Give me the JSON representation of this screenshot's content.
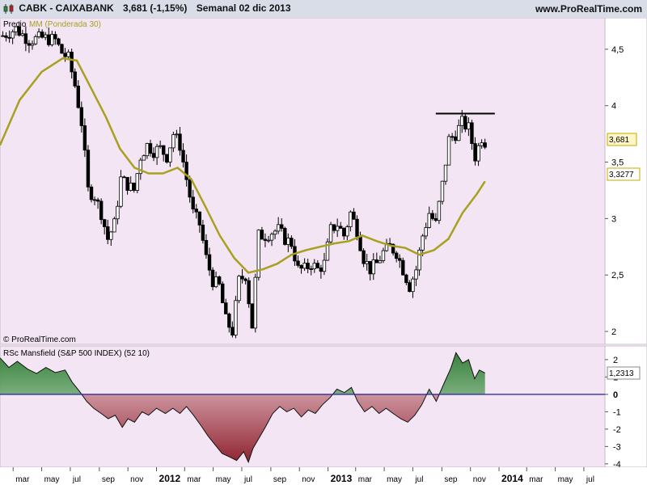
{
  "header": {
    "symbol": "CABK - CAIXABANK",
    "quote": "3,681 (-1,15%)",
    "period": "Semanal  02 dic 2013",
    "site": "www.ProRealTime.com"
  },
  "price_panel": {
    "label_precio": "Precio",
    "label_mm": "MM (Ponderada 30)",
    "copyright": "© ProRealTime.com",
    "last_price_badge": "3,681",
    "ma_badge": "3,3277"
  },
  "rsc_panel": {
    "label": "RSc Mansfield (S&P 500 INDEX) (52 10)",
    "last_badge": "1,2313"
  },
  "colors": {
    "bg_panel": "#f3e5f3",
    "ma_line": "#a8a020",
    "pos_fill": "#2e8b3a",
    "neg_fill": "#8b1a28",
    "zero_line": "#2020a0",
    "last_badge_border": "#c8a800"
  },
  "chart_data": [
    {
      "type": "candlestick",
      "title": "CABK - CAIXABANK",
      "series": [
        {
          "name": "Precio"
        },
        {
          "name": "MM (Ponderada 30)"
        }
      ],
      "yticks": [
        "4,5",
        "4",
        "3,5",
        "3",
        "2,5",
        "2"
      ],
      "ylim": [
        1.9,
        4.75
      ],
      "x_ticks": [
        "mar",
        "may",
        "jul",
        "sep",
        "nov",
        "2012",
        "mar",
        "may",
        "jul",
        "sep",
        "nov",
        "2013",
        "mar",
        "may",
        "jul",
        "sep",
        "nov",
        "2014",
        "mar",
        "may",
        "jul"
      ],
      "x_range": [
        "2011-02-01",
        "2014-08-15"
      ],
      "resistance_level": 3.93,
      "resistance_from": "2013-08-19",
      "resistance_to": "2013-12-23",
      "close_points": [
        [
          "2011-02-07",
          4.62
        ],
        [
          "2011-03-07",
          4.68
        ],
        [
          "2011-04-04",
          4.58
        ],
        [
          "2011-05-02",
          4.6
        ],
        [
          "2011-05-30",
          4.58
        ],
        [
          "2011-06-13",
          4.47
        ],
        [
          "2011-06-27",
          4.42
        ],
        [
          "2011-07-11",
          4.18
        ],
        [
          "2011-07-25",
          3.85
        ],
        [
          "2011-08-08",
          3.25
        ],
        [
          "2011-08-22",
          3.2
        ],
        [
          "2011-09-05",
          3.05
        ],
        [
          "2011-09-19",
          2.82
        ],
        [
          "2011-10-03",
          2.95
        ],
        [
          "2011-10-17",
          3.35
        ],
        [
          "2011-10-31",
          3.3
        ],
        [
          "2011-11-14",
          3.25
        ],
        [
          "2011-11-28",
          3.55
        ],
        [
          "2011-12-12",
          3.65
        ],
        [
          "2011-12-26",
          3.6
        ],
        [
          "2012-01-09",
          3.62
        ],
        [
          "2012-01-23",
          3.55
        ],
        [
          "2012-02-06",
          3.75
        ],
        [
          "2012-02-20",
          3.65
        ],
        [
          "2012-03-05",
          3.35
        ],
        [
          "2012-03-19",
          3.05
        ],
        [
          "2012-04-02",
          2.95
        ],
        [
          "2012-04-16",
          2.65
        ],
        [
          "2012-04-30",
          2.45
        ],
        [
          "2012-05-14",
          2.4
        ],
        [
          "2012-05-28",
          2.1
        ],
        [
          "2012-06-11",
          2.0
        ],
        [
          "2012-06-25",
          2.45
        ],
        [
          "2012-07-09",
          2.5
        ],
        [
          "2012-07-23",
          2.05
        ],
        [
          "2012-08-06",
          2.85
        ],
        [
          "2012-08-20",
          2.85
        ],
        [
          "2012-09-03",
          2.88
        ],
        [
          "2012-09-17",
          2.9
        ],
        [
          "2012-10-01",
          2.82
        ],
        [
          "2012-10-15",
          2.78
        ],
        [
          "2012-10-29",
          2.55
        ],
        [
          "2012-11-12",
          2.55
        ],
        [
          "2012-11-26",
          2.6
        ],
        [
          "2012-12-10",
          2.55
        ],
        [
          "2012-12-24",
          2.6
        ],
        [
          "2013-01-07",
          2.9
        ],
        [
          "2013-01-21",
          2.95
        ],
        [
          "2013-02-04",
          2.85
        ],
        [
          "2013-02-18",
          3.05
        ],
        [
          "2013-03-04",
          2.9
        ],
        [
          "2013-03-18",
          2.65
        ],
        [
          "2013-04-01",
          2.55
        ],
        [
          "2013-04-15",
          2.6
        ],
        [
          "2013-04-29",
          2.7
        ],
        [
          "2013-05-13",
          2.75
        ],
        [
          "2013-05-27",
          2.7
        ],
        [
          "2013-06-10",
          2.55
        ],
        [
          "2013-06-24",
          2.4
        ],
        [
          "2013-07-08",
          2.55
        ],
        [
          "2013-07-22",
          2.85
        ],
        [
          "2013-08-05",
          3.05
        ],
        [
          "2013-08-19",
          2.95
        ],
        [
          "2013-09-02",
          3.3
        ],
        [
          "2013-09-16",
          3.7
        ],
        [
          "2013-09-30",
          3.75
        ],
        [
          "2013-10-14",
          3.85
        ],
        [
          "2013-10-28",
          3.8
        ],
        [
          "2013-11-11",
          3.55
        ],
        [
          "2013-11-25",
          3.72
        ],
        [
          "2013-12-02",
          3.681
        ]
      ],
      "ma_points": [
        [
          "2011-02-01",
          3.65
        ],
        [
          "2011-03-15",
          4.05
        ],
        [
          "2011-05-01",
          4.3
        ],
        [
          "2011-06-15",
          4.42
        ],
        [
          "2011-07-15",
          4.4
        ],
        [
          "2011-08-15",
          4.15
        ],
        [
          "2011-09-15",
          3.9
        ],
        [
          "2011-10-15",
          3.62
        ],
        [
          "2011-11-15",
          3.45
        ],
        [
          "2011-12-15",
          3.4
        ],
        [
          "2012-01-15",
          3.4
        ],
        [
          "2012-02-15",
          3.45
        ],
        [
          "2012-03-15",
          3.35
        ],
        [
          "2012-04-15",
          3.1
        ],
        [
          "2012-05-15",
          2.85
        ],
        [
          "2012-06-15",
          2.65
        ],
        [
          "2012-07-15",
          2.52
        ],
        [
          "2012-08-15",
          2.55
        ],
        [
          "2012-09-15",
          2.6
        ],
        [
          "2012-10-15",
          2.68
        ],
        [
          "2012-11-15",
          2.72
        ],
        [
          "2012-12-15",
          2.75
        ],
        [
          "2013-01-15",
          2.78
        ],
        [
          "2013-02-15",
          2.8
        ],
        [
          "2013-03-15",
          2.85
        ],
        [
          "2013-04-15",
          2.8
        ],
        [
          "2013-05-15",
          2.76
        ],
        [
          "2013-06-15",
          2.74
        ],
        [
          "2013-07-15",
          2.68
        ],
        [
          "2013-08-15",
          2.72
        ],
        [
          "2013-09-15",
          2.82
        ],
        [
          "2013-10-15",
          3.05
        ],
        [
          "2013-11-15",
          3.22
        ],
        [
          "2013-12-02",
          3.33
        ]
      ]
    },
    {
      "type": "area",
      "title": "RSc Mansfield (S&P 500 INDEX) (52 10)",
      "yticks": [
        "2",
        "1",
        "0",
        "-1",
        "-2",
        "-3",
        "-4"
      ],
      "ylim": [
        -4.1,
        2.6
      ],
      "points": [
        [
          "2011-02-01",
          2.1
        ],
        [
          "2011-02-20",
          1.55
        ],
        [
          "2011-03-10",
          1.9
        ],
        [
          "2011-04-01",
          1.45
        ],
        [
          "2011-04-20",
          1.2
        ],
        [
          "2011-05-10",
          1.55
        ],
        [
          "2011-05-30",
          1.25
        ],
        [
          "2011-06-20",
          1.4
        ],
        [
          "2011-07-05",
          0.7
        ],
        [
          "2011-07-20",
          0.2
        ],
        [
          "2011-08-05",
          -0.4
        ],
        [
          "2011-08-20",
          -0.8
        ],
        [
          "2011-09-05",
          -1.1
        ],
        [
          "2011-09-20",
          -1.4
        ],
        [
          "2011-10-05",
          -1.2
        ],
        [
          "2011-10-20",
          -1.9
        ],
        [
          "2011-11-01",
          -1.4
        ],
        [
          "2011-11-15",
          -1.6
        ],
        [
          "2011-12-01",
          -1.0
        ],
        [
          "2011-12-15",
          -1.2
        ],
        [
          "2012-01-01",
          -0.8
        ],
        [
          "2012-01-20",
          -1.1
        ],
        [
          "2012-02-05",
          -0.8
        ],
        [
          "2012-02-20",
          -1.1
        ],
        [
          "2012-03-05",
          -0.7
        ],
        [
          "2012-03-20",
          -1.2
        ],
        [
          "2012-04-05",
          -1.8
        ],
        [
          "2012-04-20",
          -2.4
        ],
        [
          "2012-05-05",
          -2.9
        ],
        [
          "2012-05-20",
          -3.4
        ],
        [
          "2012-06-05",
          -3.6
        ],
        [
          "2012-06-20",
          -3.8
        ],
        [
          "2012-07-05",
          -3.3
        ],
        [
          "2012-07-15",
          -3.9
        ],
        [
          "2012-07-25",
          -3.1
        ],
        [
          "2012-08-05",
          -2.6
        ],
        [
          "2012-08-20",
          -1.9
        ],
        [
          "2012-09-05",
          -1.1
        ],
        [
          "2012-09-20",
          -0.7
        ],
        [
          "2012-10-05",
          -1.0
        ],
        [
          "2012-10-20",
          -0.8
        ],
        [
          "2012-11-05",
          -1.3
        ],
        [
          "2012-11-20",
          -0.9
        ],
        [
          "2012-12-05",
          -1.1
        ],
        [
          "2012-12-20",
          -0.6
        ],
        [
          "2013-01-05",
          -0.2
        ],
        [
          "2013-01-20",
          0.3
        ],
        [
          "2013-02-05",
          0.1
        ],
        [
          "2013-02-20",
          0.4
        ],
        [
          "2013-03-05",
          -0.4
        ],
        [
          "2013-03-20",
          -1.0
        ],
        [
          "2013-04-05",
          -0.7
        ],
        [
          "2013-04-20",
          -1.1
        ],
        [
          "2013-05-05",
          -0.8
        ],
        [
          "2013-05-20",
          -1.1
        ],
        [
          "2013-06-05",
          -1.4
        ],
        [
          "2013-06-20",
          -1.6
        ],
        [
          "2013-07-05",
          -1.2
        ],
        [
          "2013-07-20",
          -0.6
        ],
        [
          "2013-08-05",
          0.3
        ],
        [
          "2013-08-20",
          -0.4
        ],
        [
          "2013-09-05",
          0.6
        ],
        [
          "2013-09-20",
          1.5
        ],
        [
          "2013-10-01",
          2.4
        ],
        [
          "2013-10-15",
          1.8
        ],
        [
          "2013-10-28",
          2.0
        ],
        [
          "2013-11-10",
          0.9
        ],
        [
          "2013-11-20",
          1.4
        ],
        [
          "2013-12-02",
          1.23
        ]
      ]
    }
  ]
}
